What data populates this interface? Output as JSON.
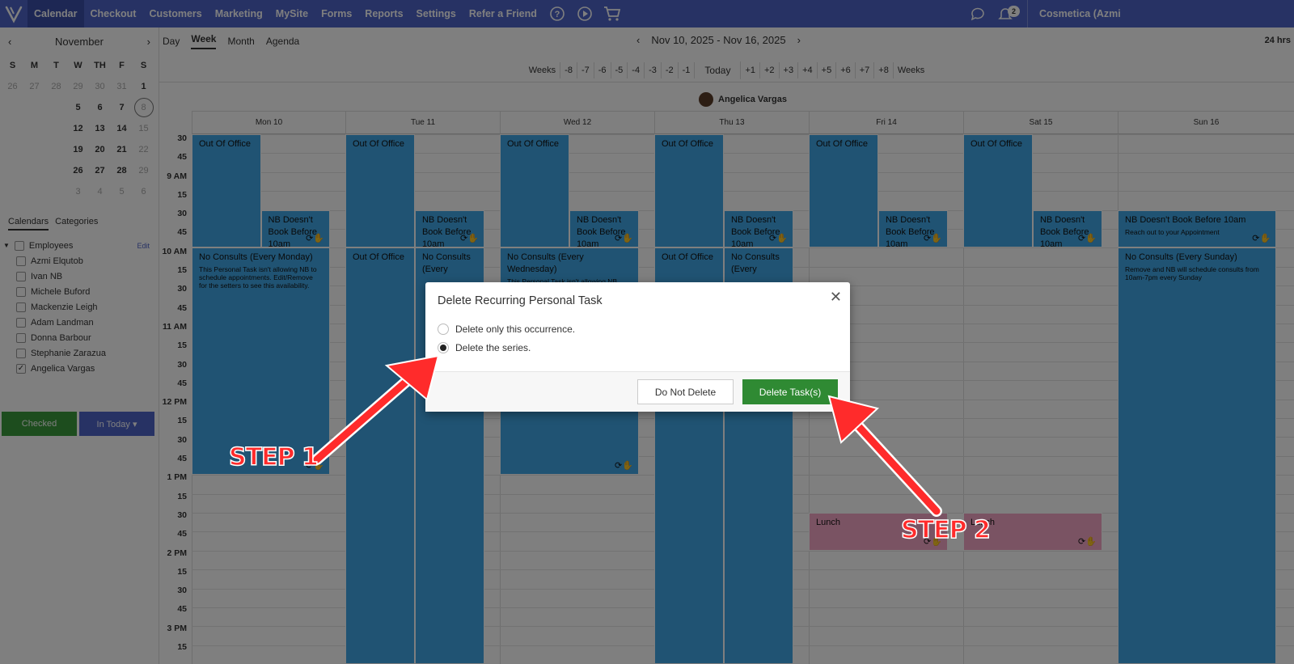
{
  "topbar": {
    "nav": [
      "Calendar",
      "Checkout",
      "Customers",
      "Marketing",
      "MySite",
      "Forms",
      "Reports",
      "Settings",
      "Refer a Friend"
    ],
    "notification_count": "2",
    "account": "Cosmetica (Azmi"
  },
  "mini_calendar": {
    "month": "November",
    "dow": [
      "S",
      "M",
      "T",
      "W",
      "TH",
      "F",
      "S"
    ],
    "weeks": [
      [
        "26",
        "27",
        "28",
        "29",
        "30",
        "31",
        "1"
      ],
      [
        "",
        "",
        "",
        "5",
        "6",
        "7",
        "8"
      ],
      [
        "",
        "",
        "",
        "12",
        "13",
        "14",
        "15"
      ],
      [
        "",
        "",
        "",
        "19",
        "20",
        "21",
        "22"
      ],
      [
        "",
        "",
        "",
        "26",
        "27",
        "28",
        "29"
      ],
      [
        "",
        "",
        "",
        "3",
        "4",
        "5",
        "6"
      ]
    ],
    "today": "8"
  },
  "sidebar": {
    "tabs": [
      "Calendars",
      "Categories"
    ],
    "group": "Employees",
    "edit": "Edit",
    "employees": [
      {
        "name": "Azmi Elqutob",
        "checked": false
      },
      {
        "name": "Ivan NB",
        "checked": false
      },
      {
        "name": "Michele Buford",
        "checked": false
      },
      {
        "name": "Mackenzie Leigh",
        "checked": false
      },
      {
        "name": "Adam Landman",
        "checked": false
      },
      {
        "name": "Donna Barbour",
        "checked": false
      },
      {
        "name": "Stephanie Zarazua",
        "checked": false
      },
      {
        "name": "Angelica Vargas",
        "checked": true
      }
    ],
    "checked_btn": "Checked",
    "in_today_btn": "In Today ▾"
  },
  "calendar": {
    "view_tabs": [
      "Day",
      "Week",
      "Month",
      "Agenda"
    ],
    "selected_view": "Week",
    "range": "Nov 10, 2025 - Nov 16, 2025",
    "hours_toggle": "24 hrs",
    "weeks_label": "Weeks",
    "week_steps": [
      "-8",
      "-7",
      "-6",
      "-5",
      "-4",
      "-3",
      "-2",
      "-1",
      "Today",
      "+1",
      "+2",
      "+3",
      "+4",
      "+5",
      "+6",
      "+7",
      "+8"
    ],
    "person": "Angelica Vargas",
    "days": [
      "Mon 10",
      "Tue 11",
      "Wed 12",
      "Thu 13",
      "Fri 14",
      "Sat 15",
      "Sun 16"
    ],
    "times": [
      "30",
      "45",
      "9 AM",
      "15",
      "30",
      "45",
      "10 AM",
      "15",
      "30",
      "45",
      "11 AM",
      "15",
      "30",
      "45",
      "12 PM",
      "15",
      "30",
      "45",
      "1 PM",
      "15",
      "30",
      "45",
      "2 PM",
      "15",
      "30",
      "45",
      "3 PM",
      "15"
    ],
    "events": {
      "out_of_office": "Out Of Office",
      "nb_doesnt_book": "NB Doesn't Book Before 10am",
      "sun_nb_desc": "Reach out to your Appointment",
      "mon_consult": "No Consults (Every Monday)",
      "mon_desc": "This Personal Task isn't allowing NB to schedule appointments. Edit/Remove for the setters to see this availability.",
      "tue_consult": "No Consults (Every",
      "wed_consult": "No Consults (Every Wednesday)",
      "wed_desc": "This Personal Task isn't allowing NB",
      "thu_consult": "No Consults (Every",
      "sun_consult": "No Consults (Every Sunday)",
      "sun_desc": "Remove and NB will schedule consults from 10am-7pm every Sunday",
      "lunch": "Lunch"
    }
  },
  "modal": {
    "title": "Delete Recurring Personal Task",
    "option1": "Delete only this occurrence.",
    "option2": "Delete the series.",
    "selected": "option2",
    "cancel": "Do Not Delete",
    "confirm": "Delete Task(s)"
  },
  "annotations": {
    "step1": "STEP 1",
    "step2": "STEP 2",
    "color": "#ff2b2b"
  },
  "colors": {
    "topbar": "#4f64c8",
    "event": "#40a7e6",
    "lunch": "#f5a7c7",
    "confirm": "#2f8a33"
  }
}
